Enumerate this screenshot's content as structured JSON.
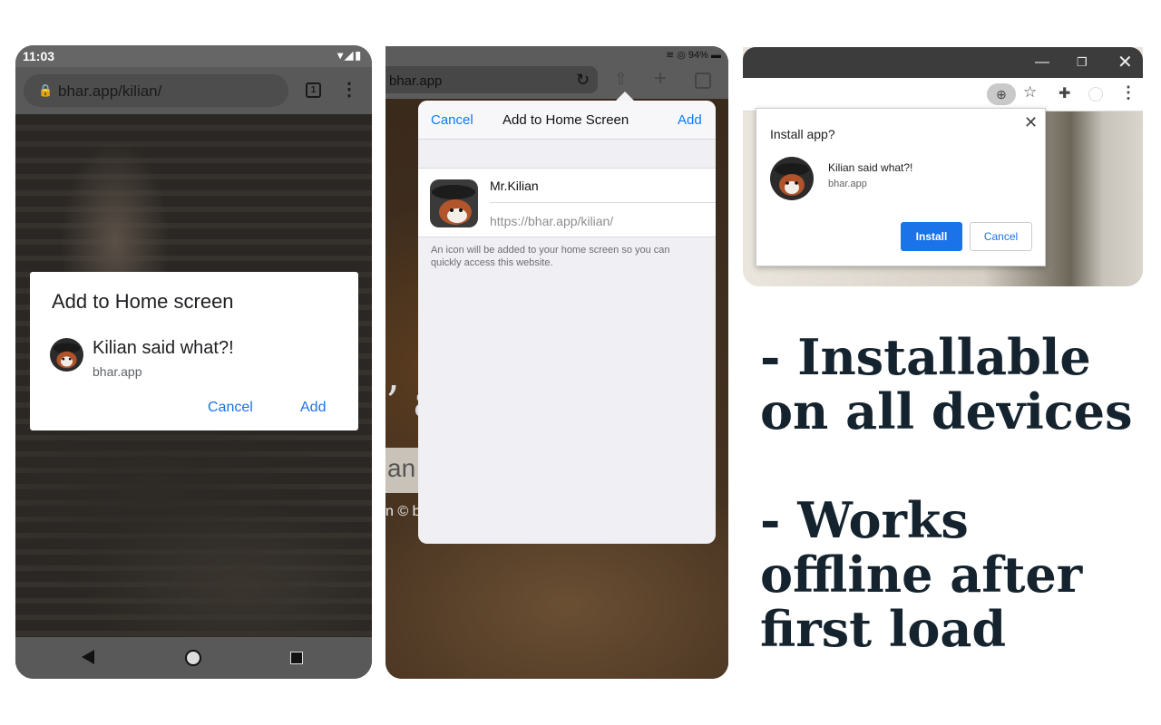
{
  "android": {
    "status_time": "11:03",
    "url": "bhar.app/kilian/",
    "tab_count": "1",
    "dialog": {
      "title": "Add to Home screen",
      "app_name": "Kilian said what?!",
      "domain": "bhar.app",
      "cancel_label": "Cancel",
      "add_label": "Add"
    }
  },
  "ipad": {
    "battery": "94%",
    "url": "bhar.app",
    "background_text_1": "’ a",
    "background_text_2": "an",
    "background_text_3": "n © b",
    "sheet": {
      "cancel_label": "Cancel",
      "title": "Add to Home Screen",
      "add_label": "Add",
      "name_value": "Mr.Kilian",
      "url_value": "https://bhar.app/kilian/",
      "note": "An icon will be added to your home screen so you can quickly access this website."
    }
  },
  "desktop": {
    "popup": {
      "title": "Install app?",
      "app_name": "Kilian said what?!",
      "domain": "bhar.app",
      "install_label": "Install",
      "cancel_label": "Cancel"
    }
  },
  "features": [
    "- Installable on all devices",
    "- Works offline after first load"
  ],
  "colors": {
    "accent_blue": "#1a73e8",
    "ios_blue": "#0a7aff",
    "feature_text": "#14232e"
  }
}
